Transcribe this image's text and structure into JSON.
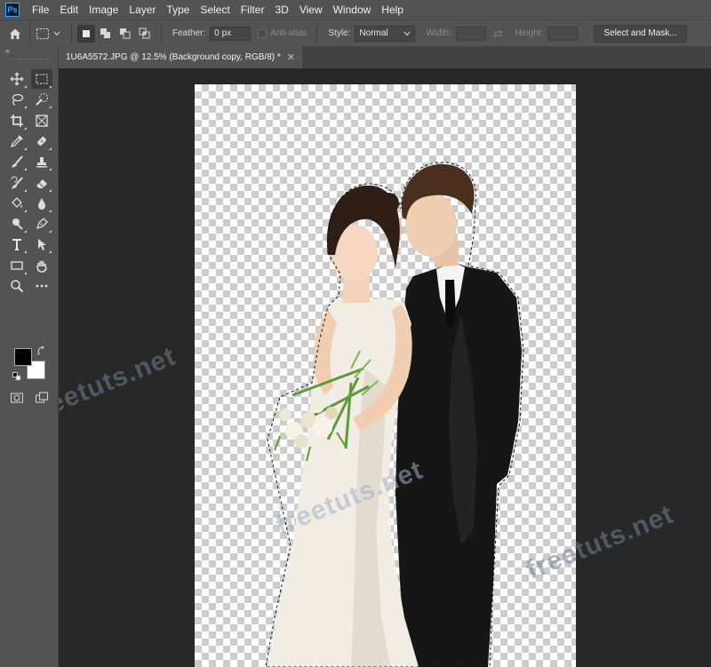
{
  "app": {
    "logo_text": "Ps"
  },
  "menu": [
    "File",
    "Edit",
    "Image",
    "Layer",
    "Type",
    "Select",
    "Filter",
    "3D",
    "View",
    "Window",
    "Help"
  ],
  "options": {
    "feather_label": "Feather:",
    "feather_value": "0 px",
    "antialias_label": "Anti-alias",
    "style_label": "Style:",
    "style_value": "Normal",
    "width_label": "Width:",
    "height_label": "Height:",
    "select_mask_label": "Select and Mask..."
  },
  "tabs": [
    {
      "label": "1U6A5572.JPG @ 12.5% (Background copy, RGB/8) *",
      "active": true
    }
  ],
  "toolbar": {
    "collapse_glyph": "«",
    "tools": [
      {
        "name": "move-icon",
        "active": false
      },
      {
        "name": "rectangular-marquee-icon",
        "active": true
      },
      {
        "name": "lasso-icon",
        "active": false
      },
      {
        "name": "quick-selection-icon",
        "active": false
      },
      {
        "name": "crop-icon",
        "active": false
      },
      {
        "name": "frame-icon",
        "active": false
      },
      {
        "name": "eyedropper-icon",
        "active": false
      },
      {
        "name": "healing-brush-icon",
        "active": false
      },
      {
        "name": "brush-icon",
        "active": false
      },
      {
        "name": "clone-stamp-icon",
        "active": false
      },
      {
        "name": "history-brush-icon",
        "active": false
      },
      {
        "name": "eraser-icon",
        "active": false
      },
      {
        "name": "paint-bucket-icon",
        "active": false
      },
      {
        "name": "blur-icon",
        "active": false
      },
      {
        "name": "dodge-icon",
        "active": false
      },
      {
        "name": "pen-icon",
        "active": false
      },
      {
        "name": "type-icon",
        "active": false
      },
      {
        "name": "path-selection-icon",
        "active": false
      },
      {
        "name": "rectangle-shape-icon",
        "active": false
      },
      {
        "name": "hand-icon",
        "active": false
      },
      {
        "name": "zoom-icon",
        "active": false
      },
      {
        "name": "more-tools-icon",
        "active": false
      }
    ],
    "foreground_color": "#000000",
    "background_color": "#ffffff"
  },
  "watermarks": [
    "freetuts.net",
    "freetuts.net",
    "freetuts.net"
  ],
  "colors": {
    "chrome": "#535353",
    "workspace": "#282828",
    "accent": "#31a8ff"
  }
}
